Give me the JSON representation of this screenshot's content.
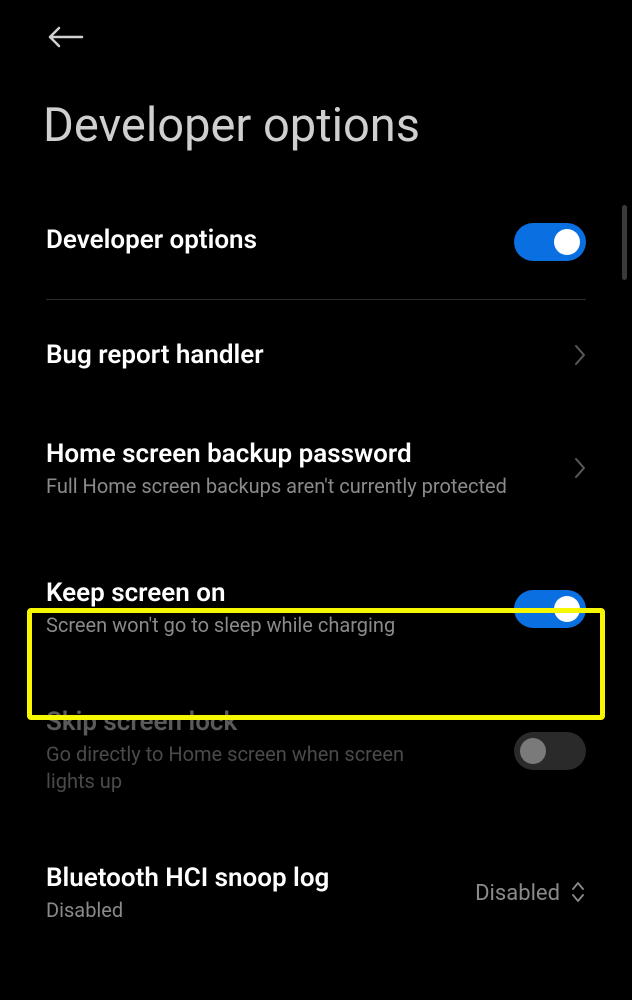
{
  "header": {
    "title": "Developer options"
  },
  "settings": {
    "developer_options": {
      "title": "Developer options",
      "toggle": true
    },
    "bug_report": {
      "title": "Bug report handler"
    },
    "backup_password": {
      "title": "Home screen backup password",
      "subtitle": "Full Home screen backups aren't currently protected"
    },
    "keep_screen_on": {
      "title": "Keep screen on",
      "subtitle": "Screen won't go to sleep while charging",
      "toggle": true
    },
    "skip_screen_lock": {
      "title": "Skip screen lock",
      "subtitle": "Go directly to Home screen when screen lights up",
      "toggle": false,
      "disabled": true
    },
    "bluetooth_hci": {
      "title": "Bluetooth HCI snoop log",
      "subtitle": "Disabled",
      "value": "Disabled"
    }
  },
  "highlight": {
    "target": "keep_screen_on"
  }
}
